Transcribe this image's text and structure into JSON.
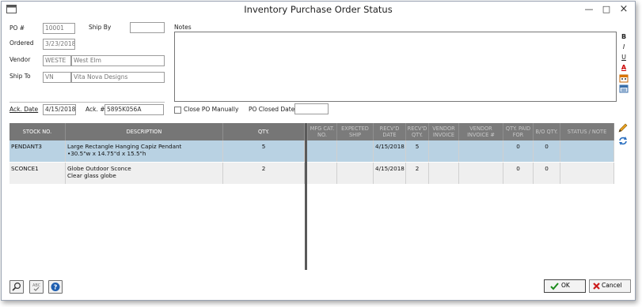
{
  "window": {
    "title": "Inventory Purchase Order Status"
  },
  "form": {
    "po_label": "PO #",
    "po_value": "10001",
    "ship_by_label": "Ship By",
    "ship_by_value": "",
    "ordered_label": "Ordered",
    "ordered_value": "3/23/2018",
    "vendor_label": "Vendor",
    "vendor_code": "WESTE",
    "vendor_name": "West Elm",
    "ship_to_label": "Ship To",
    "ship_to_code": "VN",
    "ship_to_name": "Vita Nova Designs",
    "notes_label": "Notes",
    "notes_value": "",
    "ack_date_label": "Ack. Date",
    "ack_date_value": "4/15/2018",
    "ack_no_label": "Ack. #",
    "ack_no_value": "5895K056A",
    "close_po_label": "Close PO Manually",
    "close_po_checked": false,
    "po_closed_date_label": "PO Closed Date",
    "po_closed_date_value": ""
  },
  "formatting": {
    "bold": "B",
    "italic": "I",
    "underline": "U",
    "font_color": "A"
  },
  "grid": {
    "columns": [
      "STOCK NO.",
      "DESCRIPTION",
      "QTY.",
      "MFG CAT. NO.",
      "EXPECTED SHIP",
      "RECV'D DATE",
      "RECV'D QTY.",
      "VENDOR INVOICE",
      "VENDOR INVOICE #",
      "QTY. PAID FOR",
      "B/O QTY.",
      "STATUS / NOTE"
    ],
    "rows": [
      {
        "stock_no": "PENDANT3",
        "desc1": "Large Rectangle Hanging Capiz Pendant",
        "desc2": "•30.5\"w x 14.75\"d x 15.5\"h",
        "qty": "5",
        "mfg_cat_no": "",
        "expected_ship": "",
        "recvd_date": "4/15/2018",
        "recvd_qty": "5",
        "vendor_invoice": "",
        "vendor_invoice_no": "",
        "qty_paid": "0",
        "bo_qty": "0",
        "status_note": ""
      },
      {
        "stock_no": "SCONCE1",
        "desc1": "Globe Outdoor Sconce",
        "desc2": "Clear glass globe",
        "qty": "2",
        "mfg_cat_no": "",
        "expected_ship": "",
        "recvd_date": "4/15/2018",
        "recvd_qty": "2",
        "vendor_invoice": "",
        "vendor_invoice_no": "",
        "qty_paid": "0",
        "bo_qty": "0",
        "status_note": ""
      }
    ]
  },
  "buttons": {
    "ok": "OK",
    "cancel": "Cancel"
  },
  "colors": {
    "header_bg": "#767676",
    "selected_row": "#b9d2e3",
    "row_alt": "#efefef"
  }
}
